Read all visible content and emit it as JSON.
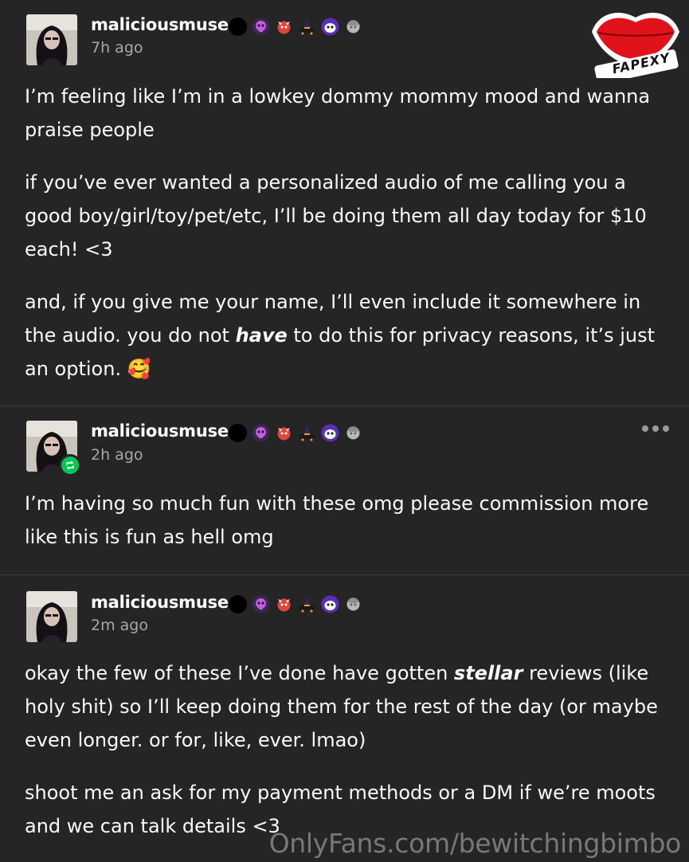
{
  "posts": [
    {
      "username": "maliciousmuse",
      "timestamp": "7h ago",
      "paragraphs": [
        {
          "text": "I’m feeling like I’m in a lowkey dommy mommy mood and wanna praise people"
        },
        {
          "text": "if you’ve ever wanted a personalized audio of me calling you a good boy/girl/toy/pet/etc, I’ll be doing them all day today for $10 each! <3"
        },
        {
          "before": "and, if you give me your name, I’ll even include it somewhere in the audio. you do not ",
          "emph": "have",
          "after": " to do this for privacy reasons, it’s just an option. 🥰"
        }
      ]
    },
    {
      "username": "maliciousmuse",
      "timestamp": "2h ago",
      "reblogged": true,
      "paragraphs": [
        {
          "text": "I’m having so much fun with these omg please commission more like this is fun as hell omg"
        }
      ]
    },
    {
      "username": "maliciousmuse",
      "timestamp": "2m ago",
      "paragraphs": [
        {
          "before": "okay the few of these I’ve done have gotten ",
          "emph": "stellar",
          "after": " reviews (like holy shit) so I’ll keep doing them for the rest of the day (or maybe even longer. or for, like, ever. lmao)"
        },
        {
          "text": "shoot me an ask for my payment methods or a DM if we’re moots and we can talk details <3"
        }
      ]
    }
  ],
  "badges": [
    "black-dot-icon",
    "purple-skull-icon",
    "red-devil-icon",
    "witch-hat-icon",
    "purple-face-icon",
    "gray-statue-icon"
  ],
  "watermark": {
    "logo_text": "FAPEXY",
    "url_text": "OnlyFans.com/bewitchingbimbo"
  },
  "colors": {
    "background": "#252525",
    "text": "#ffffff",
    "muted": "#a8a8a8",
    "reblog_green": "#00c853",
    "lips_red": "#e0121b"
  }
}
